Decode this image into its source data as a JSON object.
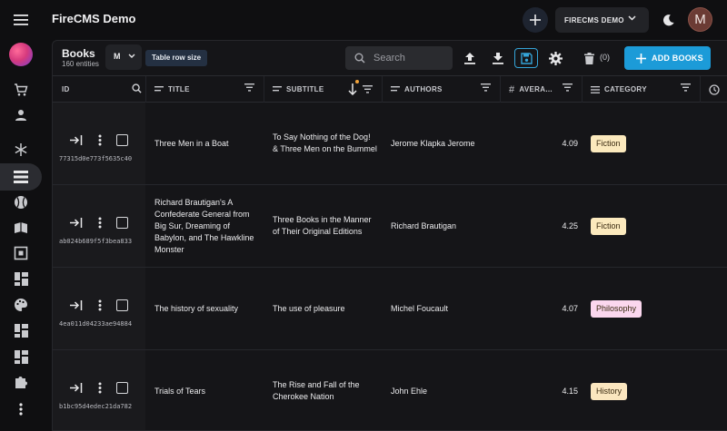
{
  "app": {
    "title": "FireCMS Demo",
    "project_label": "FIRECMS DEMO",
    "avatar_initial": "M"
  },
  "collection": {
    "title": "Books",
    "count_label": "160 entities",
    "row_size_value": "M",
    "row_size_tooltip": "Table row size",
    "search_placeholder": "Search",
    "delete_count": "(0)",
    "add_label": "ADD BOOKS"
  },
  "columns": [
    {
      "key": "id",
      "label": "ID"
    },
    {
      "key": "title",
      "label": "TITLE"
    },
    {
      "key": "subtitle",
      "label": "SUBTITLE"
    },
    {
      "key": "authors",
      "label": "AUTHORS"
    },
    {
      "key": "average",
      "label": "AVERA..."
    },
    {
      "key": "category",
      "label": "CATEGORY"
    }
  ],
  "rows": [
    {
      "id": "77315d0e773f5635c40",
      "title": "Three Men in a Boat",
      "subtitle": "To Say Nothing of the Dog! & Three Men on the Bummel",
      "authors": "Jerome Klapka Jerome",
      "average": "4.09",
      "category": "Fiction",
      "category_bg": "#fbe9bd"
    },
    {
      "id": "ab024b689f5f3bea833",
      "title": "Richard Brautigan's A Confederate General from Big Sur, Dreaming of Babylon, and The Hawkline Monster",
      "subtitle": "Three Books in the Manner of Their Original Editions",
      "authors": "Richard Brautigan",
      "average": "4.25",
      "category": "Fiction",
      "category_bg": "#fbe9bd"
    },
    {
      "id": "4ea011d04233ae94884",
      "title": "The history of sexuality",
      "subtitle": "The use of pleasure",
      "authors": "Michel Foucault",
      "average": "4.07",
      "category": "Philosophy",
      "category_bg": "#fbd7ee"
    },
    {
      "id": "b1bc95d4edec21da782",
      "title": "Trials of Tears",
      "subtitle": "The Rise and Fall of the Cherokee Nation",
      "authors": "John Ehle",
      "average": "4.15",
      "category": "History",
      "category_bg": "#fbe6bf"
    }
  ],
  "colors": {
    "accent": "#1c9bd8",
    "sort_dot": "#f0a23a",
    "background": "#0f0f11"
  }
}
